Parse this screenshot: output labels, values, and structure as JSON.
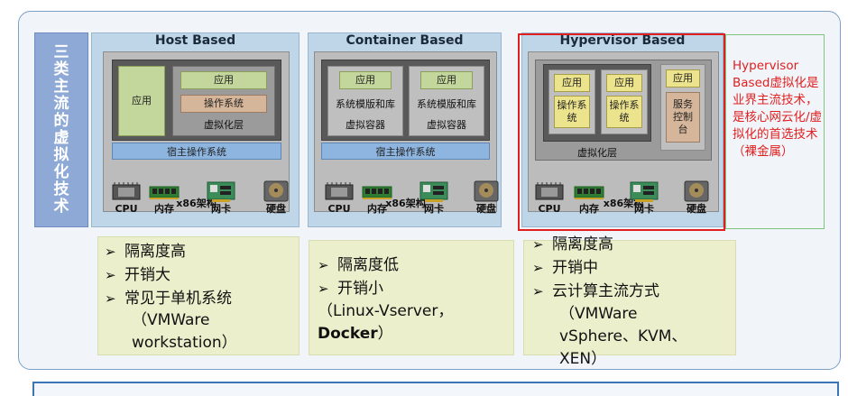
{
  "side_label": "三类主流的虚拟化技术",
  "host_based": {
    "title": "Host Based",
    "app_left": "应用",
    "app_right": "应用",
    "os": "操作系统",
    "virt_layer": "虚拟化层",
    "host_os": "宿主操作系统",
    "arch": "x86架构",
    "bullets": [
      "隔离度高",
      "开销大",
      "常见于单机系统"
    ],
    "cont": [
      "（VMWare",
      "workstation）"
    ]
  },
  "container_based": {
    "title": "Container Based",
    "app1": "应用",
    "app2": "应用",
    "libs1": "系统模版和库",
    "libs2": "系统模版和库",
    "vc1": "虚拟容器",
    "vc2": "虚拟容器",
    "host_os": "宿主操作系统",
    "arch": "x86架构",
    "bullets": [
      "隔离度低",
      "开销小"
    ],
    "cont_prefix": "（Linux-Vserver，",
    "cont_bold": "Docker",
    "cont_suffix": "）"
  },
  "hypervisor_based": {
    "title": "Hypervisor Based",
    "app1": "应用",
    "app2": "应用",
    "app3": "应用",
    "os1": "操作系统",
    "os2": "操作系统",
    "svc": "服务控制台",
    "virt_layer": "虚拟化层",
    "arch": "x86架构",
    "bullets": [
      "隔离度高",
      "开销中",
      "云计算主流方式"
    ],
    "cont": [
      "（VMWare",
      "vSphere、KVM、",
      "XEN）"
    ]
  },
  "hardware": {
    "cpu": "CPU",
    "mem": "内存",
    "nic": "网卡",
    "disk": "硬盘"
  },
  "red_note": "Hypervisor Based虚拟化是业界主流技术，是核心网云化/虚拟化的首选技术（裸金属）",
  "colors": {
    "accent_red": "#e02020",
    "panel_blue": "#bfd5e8",
    "side_blue": "#8ea9d6",
    "bullet_bg": "#ecefcc"
  }
}
